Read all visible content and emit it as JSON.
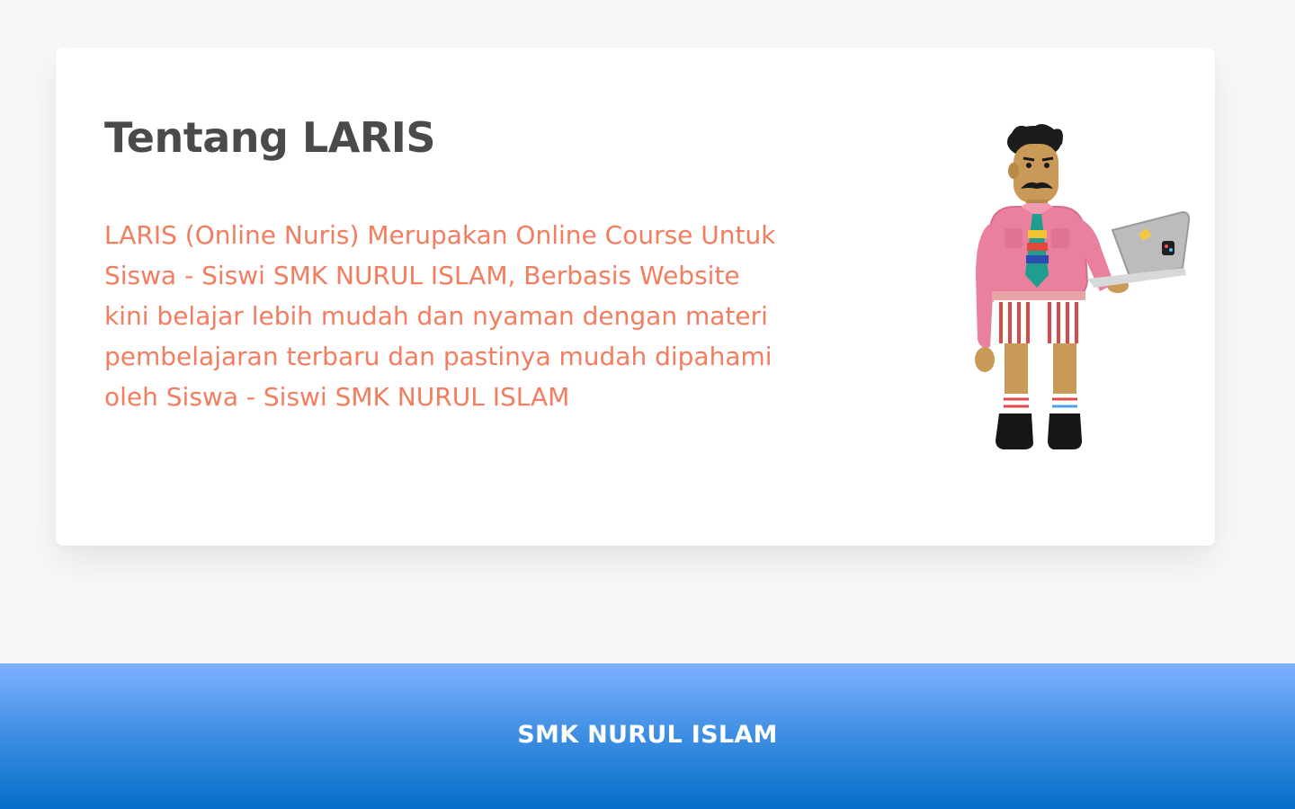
{
  "about": {
    "title": "Tentang LARIS",
    "description_lines": [
      "LARIS (Online Nuris) Merupakan Online Course Untuk",
      "Siswa - Siswi  SMK NURUL ISLAM, Berbasis Website",
      "kini belajar lebih mudah dan nyaman dengan materi",
      "pembelajaran terbaru dan pastinya mudah dipahami",
      "oleh Siswa - Siswi SMK NURUL ISLAM"
    ],
    "illustration_icon": "man-holding-laptop-illustration"
  },
  "footer": {
    "title": "SMK NURUL ISLAM"
  },
  "colors": {
    "background": "#f8f8f8",
    "card": "#ffffff",
    "title": "#4a4a4a",
    "accent_text": "#f47c5f",
    "footer_top": "#7fb0ff",
    "footer_bottom": "#056fca"
  }
}
